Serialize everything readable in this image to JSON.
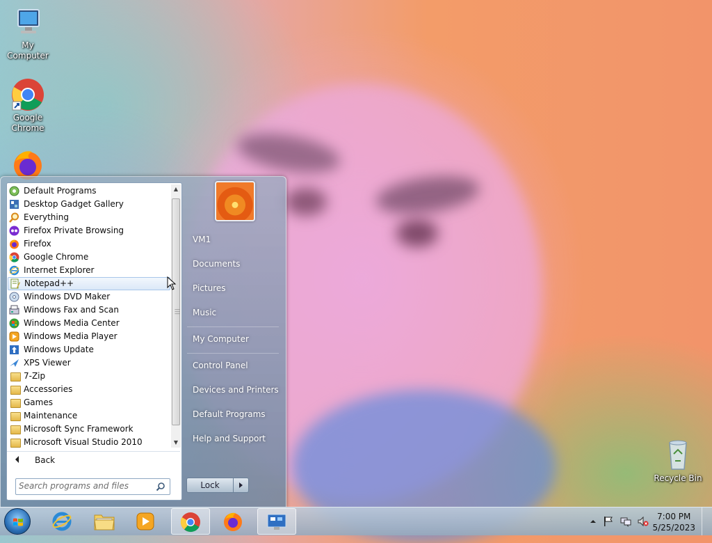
{
  "desktop": {
    "icons": [
      {
        "label": "My Computer",
        "icon": "computer-icon"
      },
      {
        "label": "Google Chrome",
        "icon": "chrome-icon"
      },
      {
        "label": "",
        "icon": "firefox-icon"
      },
      {
        "label": "Recycle Bin",
        "icon": "recycle-bin-icon"
      }
    ]
  },
  "start_menu": {
    "programs": [
      {
        "label": "Default Programs",
        "icon": "default-programs-icon"
      },
      {
        "label": "Desktop Gadget Gallery",
        "icon": "gadget-gallery-icon"
      },
      {
        "label": "Everything",
        "icon": "everything-search-icon"
      },
      {
        "label": "Firefox Private Browsing",
        "icon": "firefox-private-icon"
      },
      {
        "label": "Firefox",
        "icon": "firefox-icon"
      },
      {
        "label": "Google Chrome",
        "icon": "chrome-icon"
      },
      {
        "label": "Internet Explorer",
        "icon": "ie-icon"
      },
      {
        "label": "Notepad++",
        "icon": "notepadpp-icon",
        "selected": true
      },
      {
        "label": "Windows DVD Maker",
        "icon": "dvd-maker-icon"
      },
      {
        "label": "Windows Fax and Scan",
        "icon": "fax-scan-icon"
      },
      {
        "label": "Windows Media Center",
        "icon": "media-center-icon"
      },
      {
        "label": "Windows Media Player",
        "icon": "media-player-icon"
      },
      {
        "label": "Windows Update",
        "icon": "windows-update-icon"
      },
      {
        "label": "XPS Viewer",
        "icon": "xps-viewer-icon"
      },
      {
        "label": "7-Zip",
        "icon": "folder-icon"
      },
      {
        "label": "Accessories",
        "icon": "folder-icon"
      },
      {
        "label": "Games",
        "icon": "folder-icon"
      },
      {
        "label": "Maintenance",
        "icon": "folder-icon"
      },
      {
        "label": "Microsoft Sync Framework",
        "icon": "folder-icon"
      },
      {
        "label": "Microsoft Visual Studio 2010",
        "icon": "folder-icon"
      }
    ],
    "back_label": "Back",
    "search_placeholder": "Search programs and files",
    "right_links": {
      "user": "VM1",
      "documents": "Documents",
      "pictures": "Pictures",
      "music": "Music",
      "my_computer": "My Computer",
      "control_panel": "Control Panel",
      "devices_printers": "Devices and Printers",
      "default_programs": "Default Programs",
      "help_support": "Help and Support"
    },
    "lock_label": "Lock"
  },
  "taskbar": {
    "pinned": [
      {
        "name": "internet-explorer",
        "icon": "ie-icon"
      },
      {
        "name": "file-explorer",
        "icon": "folder-icon"
      },
      {
        "name": "media-player",
        "icon": "media-player-icon"
      },
      {
        "name": "google-chrome",
        "icon": "chrome-icon",
        "active": true
      },
      {
        "name": "firefox",
        "icon": "firefox-icon"
      },
      {
        "name": "remote-desktop",
        "icon": "remote-desktop-icon",
        "active": true
      }
    ],
    "clock": {
      "time": "7:00 PM",
      "date": "5/25/2023"
    }
  },
  "colors": {
    "accent": "#3a7bd5",
    "selection": "#dbe8f8"
  }
}
